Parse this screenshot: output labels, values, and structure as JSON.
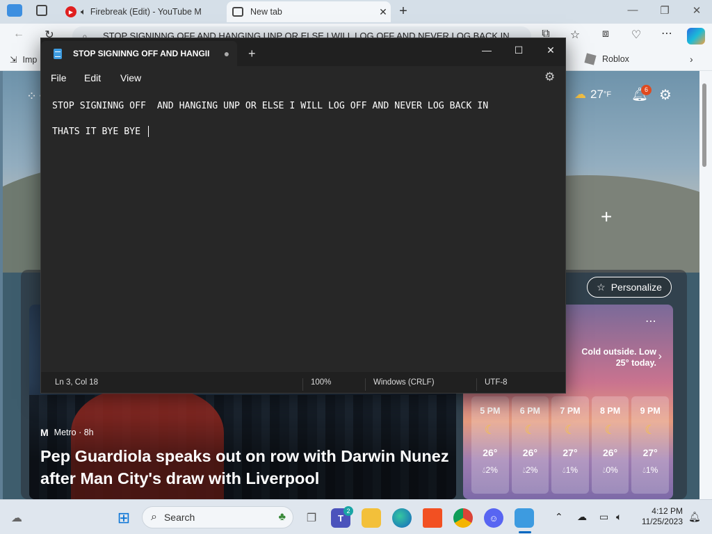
{
  "browser": {
    "tabs": [
      {
        "title": "Firebreak (Edit) - YouTube M"
      },
      {
        "title": "New tab"
      }
    ],
    "address": "STOP SIGNINNG OFF  AND HANGING UNP OR ELSE I WILL LOG OFF AND NEVER LOG BACK IN",
    "favorites": [
      {
        "label": "Imp"
      },
      {
        "label": "Roblox"
      }
    ]
  },
  "ntp": {
    "temperature": "27",
    "temp_unit": "°F",
    "notification_count": "6",
    "personalize_label": "Personalize",
    "news": {
      "source": "Metro · 8h",
      "headline": "Pep Guardiola speaks out on row with Darwin Nunez after Man City's draw with Liverpool"
    },
    "weather": {
      "summary": "Cold outside. Low 25° today.",
      "hours": [
        {
          "time": "5 PM",
          "temp": "26°",
          "precip": "2%"
        },
        {
          "time": "6 PM",
          "temp": "26°",
          "precip": "2%"
        },
        {
          "time": "7 PM",
          "temp": "27°",
          "precip": "1%"
        },
        {
          "time": "8 PM",
          "temp": "26°",
          "precip": "0%"
        },
        {
          "time": "9 PM",
          "temp": "27°",
          "precip": "1%"
        }
      ]
    }
  },
  "notepad": {
    "tab_title": "STOP SIGNINNG OFF  AND HANGII",
    "menu": {
      "file": "File",
      "edit": "Edit",
      "view": "View"
    },
    "lines": [
      "STOP SIGNINNG OFF  AND HANGING UNP OR ELSE I WILL LOG OFF AND NEVER LOG BACK IN",
      "THATS IT BYE BYE "
    ],
    "status": {
      "position": "Ln 3, Col 18",
      "zoom": "100%",
      "line_ending": "Windows (CRLF)",
      "encoding": "UTF-8"
    }
  },
  "taskbar": {
    "search_label": "Search",
    "teams_badge": "2",
    "time": "4:12 PM",
    "date": "11/25/2023"
  },
  "icons": {
    "start": "windows-logo",
    "edge": "edge-icon",
    "chrome": "chrome-icon",
    "discord": "discord-icon",
    "notepad": "notepad-icon"
  },
  "colors": {
    "notepad_bg": "#272727",
    "accent": "#0067c0",
    "badge": "#e04a1f"
  }
}
